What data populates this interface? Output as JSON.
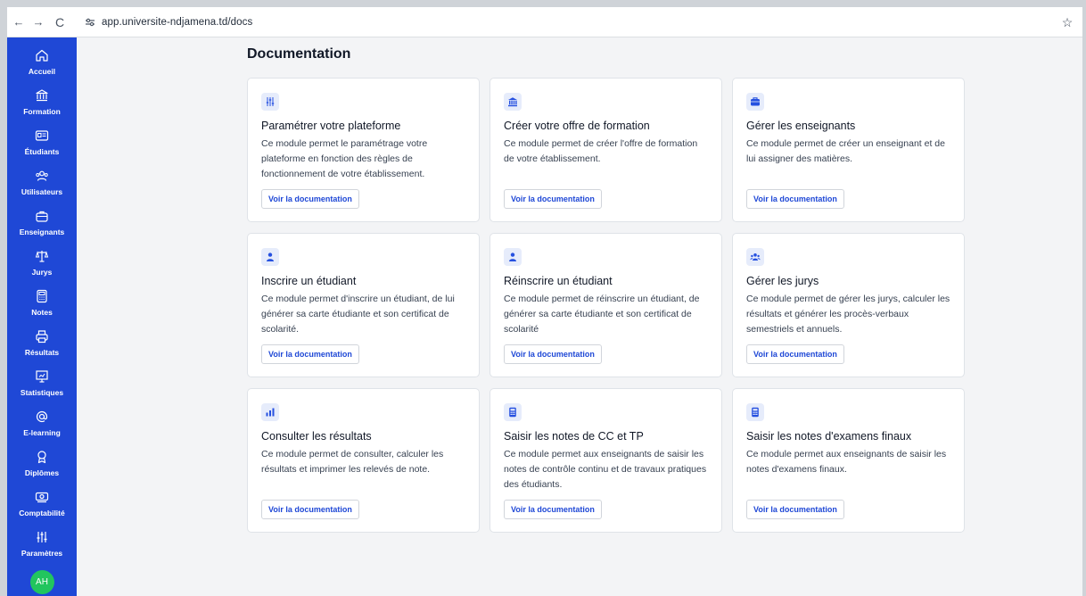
{
  "browser": {
    "url": "app.universite-ndjamena.td/docs",
    "back_icon": "←",
    "forward_icon": "→",
    "reload_icon": "C",
    "star_icon": "☆"
  },
  "sidebar": {
    "accent": "#1f48d6",
    "items": [
      {
        "label": "Accueil",
        "icon": "home-icon"
      },
      {
        "label": "Formation",
        "icon": "bank-icon"
      },
      {
        "label": "Étudiants",
        "icon": "id-card-icon"
      },
      {
        "label": "Utilisateurs",
        "icon": "users-icon"
      },
      {
        "label": "Enseignants",
        "icon": "briefcase-icon"
      },
      {
        "label": "Jurys",
        "icon": "scale-icon"
      },
      {
        "label": "Notes",
        "icon": "calculator-icon"
      },
      {
        "label": "Résultats",
        "icon": "printer-icon"
      },
      {
        "label": "Statistiques",
        "icon": "presentation-icon"
      },
      {
        "label": "E-learning",
        "icon": "at-icon"
      },
      {
        "label": "Diplômes",
        "icon": "award-icon"
      },
      {
        "label": "Comptabilité",
        "icon": "money-icon"
      },
      {
        "label": "Paramètres",
        "icon": "sliders-icon"
      }
    ],
    "avatar": "AH"
  },
  "main": {
    "title": "Documentation",
    "button_label": "Voir la documentation",
    "cards": [
      {
        "icon": "sliders-icon",
        "title": "Paramétrer votre plateforme",
        "desc": "Ce module permet le paramétrage votre plateforme en fonction des règles de fonctionnement de votre établissement.",
        "button": "Voir la documentation"
      },
      {
        "icon": "bank-icon",
        "title": "Créer votre offre de formation",
        "desc": "Ce module permet de créer l'offre de formation de votre établissement.",
        "button": "Voir la documentation"
      },
      {
        "icon": "briefcase-icon",
        "title": "Gérer les enseignants",
        "desc": "Ce module permet de créer un enseignant et de lui assigner des matières.",
        "button": "Voir la documentation"
      },
      {
        "icon": "user-icon",
        "title": "Inscrire un étudiant",
        "desc": "Ce module permet d'inscrire un étudiant, de lui générer sa carte étudiante et son certificat de scolarité.",
        "button": "Voir la documentation"
      },
      {
        "icon": "user-icon",
        "title": "Réinscrire un étudiant",
        "desc": "Ce module permet de réinscrire un étudiant, de générer sa carte étudiante et son certificat de scolarité",
        "button": "Voir la documentation"
      },
      {
        "icon": "users-icon",
        "title": "Gérer les jurys",
        "desc": "Ce module permet de gérer les jurys, calculer les résultats et générer les procès-verbaux semestriels et annuels.",
        "button": "Voir la documentation"
      },
      {
        "icon": "bar-chart-icon",
        "title": "Consulter les résultats",
        "desc": "Ce module permet de consulter, calculer les résultats et imprimer les relevés de note.",
        "button": "Voir la documentation"
      },
      {
        "icon": "calculator-icon",
        "title": "Saisir les notes de CC et TP",
        "desc": "Ce module permet aux enseignants de saisir les notes de contrôle continu et de travaux pratiques des étudiants.",
        "button": "Voir la documentation"
      },
      {
        "icon": "calculator-icon",
        "title": "Saisir les notes d'examens finaux",
        "desc": "Ce module permet aux enseignants de saisir les notes d'examens finaux.",
        "button": "Voir la documentation"
      }
    ]
  }
}
